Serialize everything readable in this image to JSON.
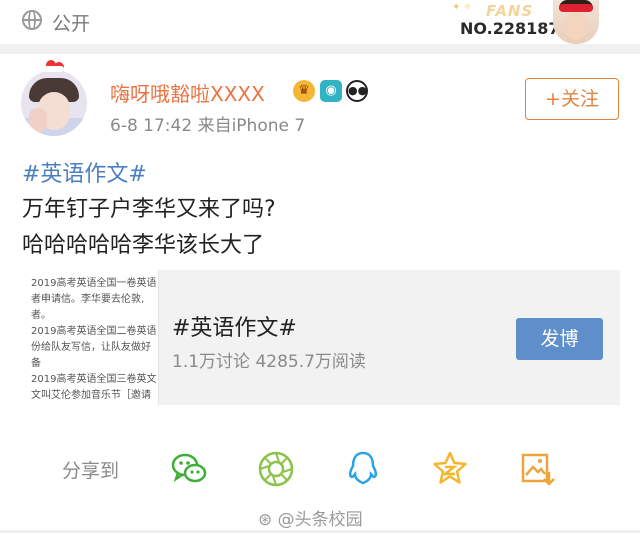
{
  "header": {
    "visibility_icon": "globe-icon",
    "visibility_label": "公开",
    "fans_badge": {
      "word": "FANS",
      "number": "NO.228187"
    }
  },
  "post": {
    "author": {
      "name": "嗨呀哦豁啦XXXX",
      "badges": [
        "vip-crown-icon",
        "camera-icon",
        "panda-icon"
      ]
    },
    "timestamp": "6-8 17:42",
    "source_prefix": "来自",
    "device": "iPhone 7",
    "follow_label": "+关注",
    "hashtag": "#英语作文#",
    "lines": [
      "万年钉子户李华又来了吗?",
      "哈哈哈哈哈李华该长大了"
    ]
  },
  "topic_card": {
    "thumbnail_lines": [
      "2019高考英语全国一卷英语",
      "者申请信。李华要去伦敦,",
      "者。",
      "2019高考英语全国二卷英语",
      "份给队友写信，让队友做好",
      "备",
      "2019高考英语全国三卷英文",
      "文叫艾伦参加音乐节［邀请"
    ],
    "title": "#英语作文#",
    "discussions": "1.1万讨论",
    "reads": "4285.7万阅读",
    "post_button": "发博"
  },
  "share": {
    "label": "分享到",
    "targets": [
      "wechat-icon",
      "moments-icon",
      "qq-icon",
      "qzone-icon",
      "save-image-icon"
    ]
  },
  "watermark": "头条校园",
  "colors": {
    "orange": "#eb7340",
    "link_blue": "#4b7fc1",
    "button_blue": "#5f8fca",
    "wechat_green": "#3cb035",
    "moments_green": "#8bc34a",
    "qq_blue": "#2aa2e3",
    "qzone_yellow": "#f6b62c",
    "save_orange": "#f0a33a"
  }
}
